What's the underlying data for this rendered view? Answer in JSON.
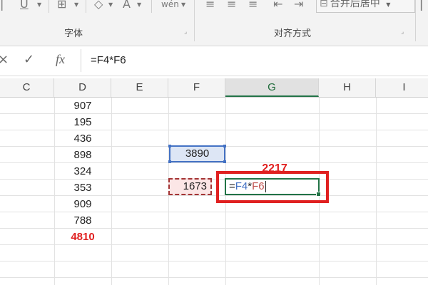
{
  "ribbon": {
    "font_group_label": "字体",
    "alignment_group_label": "对齐方式",
    "merge_center_label": "合并后居中",
    "font_color_glyph": "A",
    "phonetic_glyph": "wén"
  },
  "formula_bar": {
    "cancel_glyph": "×",
    "enter_glyph": "✓",
    "fx_label": "fx",
    "formula": "=F4*F6"
  },
  "columns": [
    "C",
    "D",
    "E",
    "F",
    "G",
    "H",
    "I"
  ],
  "active_column": "G",
  "cells": {
    "d_values": [
      "907",
      "195",
      "436",
      "898",
      "324",
      "353",
      "909",
      "788"
    ],
    "d_total": "4810",
    "f9": "3890",
    "f11": "1673",
    "g10": "2217",
    "g11_prefix": "=",
    "g11_ref1": "F4",
    "g11_op": "*",
    "g11_ref2": "F6"
  },
  "colors": {
    "accent_green": "#217346",
    "highlight_red": "#e02020",
    "ref_blue": "#4472c4",
    "ref_red": "#c0504d"
  }
}
